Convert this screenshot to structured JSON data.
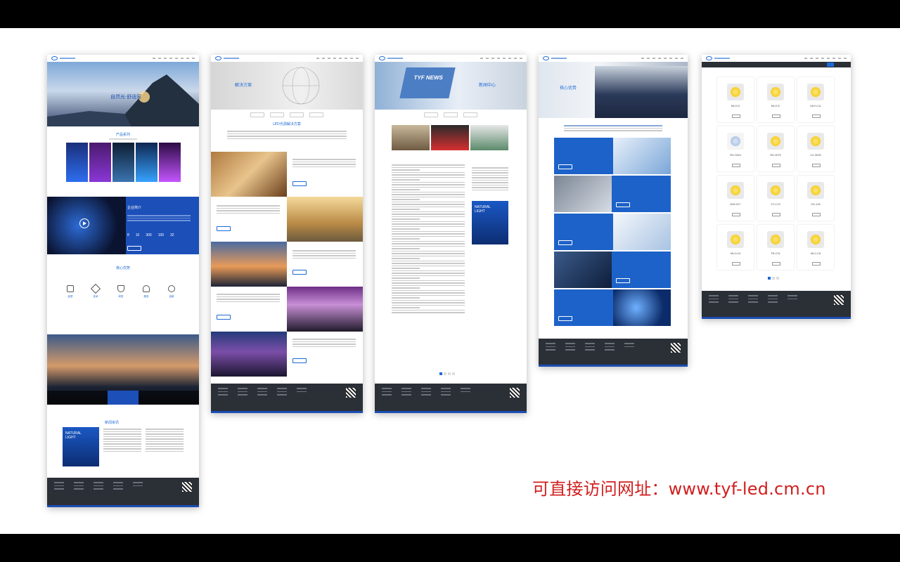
{
  "annotation": {
    "url_text": "可直接访问网址：www.tyf-led.cm.cn"
  },
  "panel_home": {
    "hero_caption": "自然光·舒适家",
    "products_title": "产品系列",
    "about_title": "企业简介",
    "core_title": "核心优势",
    "about_stats": [
      "8",
      "10",
      "300",
      "100",
      "32"
    ],
    "news_title": "新闻资讯",
    "promo_title": "NATURAL LIGHT",
    "feature_labels": [
      "品质",
      "技术",
      "研发",
      "服务",
      "创新"
    ]
  },
  "panel_solutions": {
    "hero_caption": "解决方案",
    "section_title": "LED光源解决方案"
  },
  "panel_news": {
    "hero_caption": "新闻中心",
    "banner_text": "TYF NEWS",
    "promo_title": "NATURAL LIGHT"
  },
  "panel_advantages": {
    "hero_caption": "核心优势"
  },
  "panel_products": {
    "products": [
      "MLH-D",
      "MLH-E",
      "MLH-CA",
      "RD-SW4",
      "RD-WT5",
      "LD-3005",
      "WW-027",
      "ZY-C19",
      "ZH-126",
      "ML0-LB",
      "TB-C01",
      "ML0-C8"
    ]
  }
}
